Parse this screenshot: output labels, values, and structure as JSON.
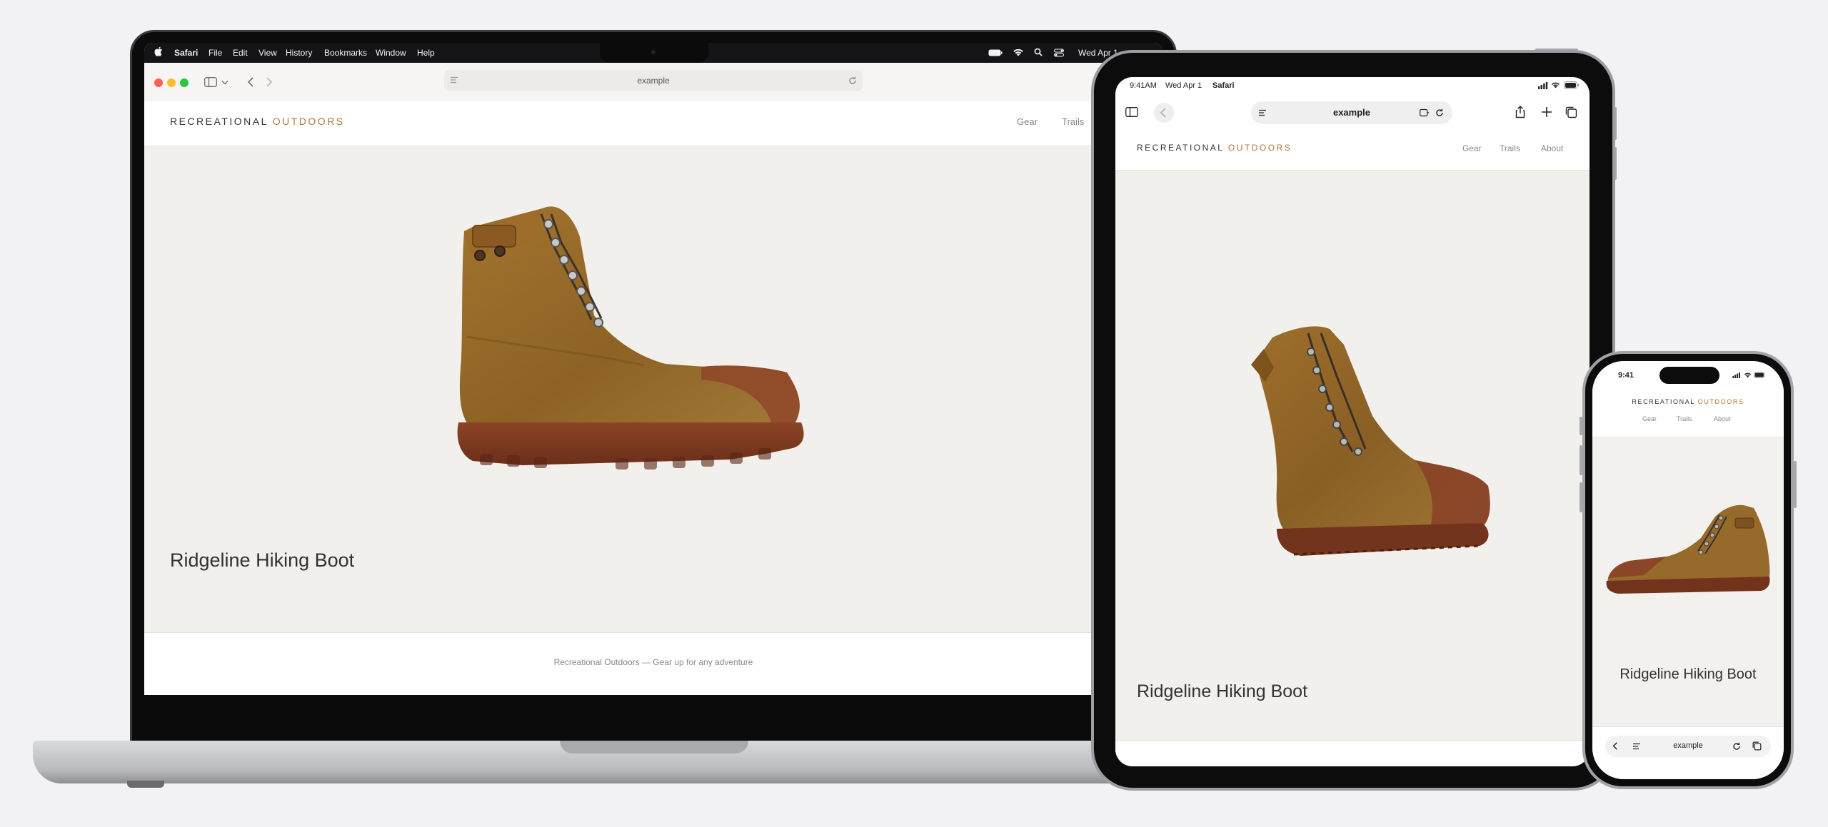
{
  "macbook": {
    "menubar": {
      "apple": "",
      "app": "Safari",
      "menus": [
        "File",
        "Edit",
        "View",
        "History",
        "Bookmarks",
        "Window",
        "Help"
      ],
      "clock": "Wed Apr 1"
    },
    "toolbar": {
      "address": "example"
    },
    "site": {
      "brand_a": "RECREATIONAL",
      "brand_b": "OUTDOORS",
      "nav": [
        "Gear",
        "Trails"
      ],
      "product_title": "Ridgeline Hiking Boot",
      "footer": "Recreational Outdoors — Gear up for any adventure"
    }
  },
  "ipad": {
    "status": {
      "time": "9:41AM",
      "date": "Wed Apr 1",
      "app": "Safari"
    },
    "toolbar": {
      "address": "example"
    },
    "site": {
      "brand_a": "RECREATIONAL",
      "brand_b": "OUTDOORS",
      "nav": [
        "Gear",
        "Trails",
        "About"
      ],
      "product_title": "Ridgeline Hiking Boot"
    }
  },
  "iphone": {
    "status": {
      "time": "9:41"
    },
    "site": {
      "brand_a": "RECREATIONAL",
      "brand_b": "OUTDOORS",
      "nav": [
        "Gear",
        "Trails",
        "About"
      ],
      "product_title": "Ridgeline Hiking Boot"
    },
    "toolbar": {
      "address": "example"
    }
  },
  "colors": {
    "accent": "#b5733d",
    "page_bg": "#f2f2f4",
    "site_bg": "#f2f0ec",
    "boot_leather": "#9a6a2c",
    "boot_sole": "#7a3a22"
  },
  "icons": [
    "apple-icon",
    "wifi-icon",
    "search-icon",
    "control-center-icon",
    "battery-icon",
    "sidebar-icon",
    "chevron-down-icon",
    "back-icon",
    "forward-icon",
    "reader-icon",
    "reload-icon",
    "share-icon",
    "plus-icon",
    "tabs-icon",
    "signal-icon",
    "extensions-icon"
  ]
}
